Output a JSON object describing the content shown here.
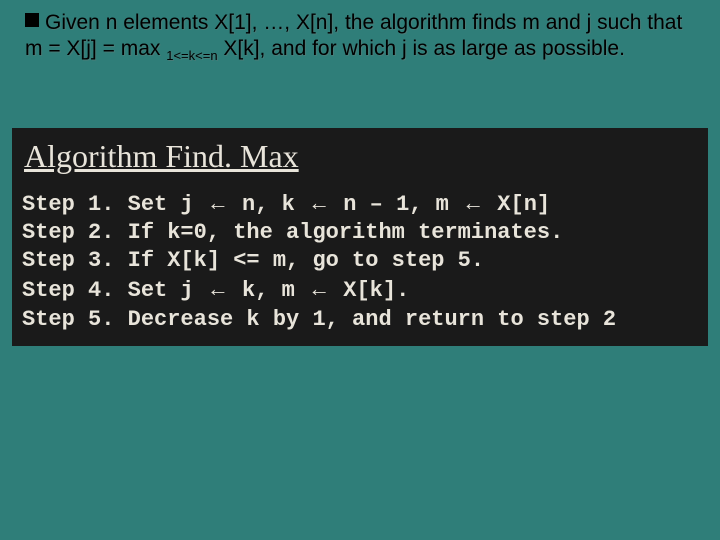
{
  "intro": {
    "part1": "Given n elements X[1], …, X[n], the algorithm finds m and j such that m = X[j] = max ",
    "subscript": "1<=k<=n",
    "part2": " X[k], and for which j is as large as possible."
  },
  "algorithm": {
    "title": "Algorithm Find. Max",
    "steps": {
      "s1a": "Step 1. Set j ",
      "s1b": " n, k ",
      "s1c": " n – 1, m ",
      "s1d": " X[n]",
      "s2": "Step 2. If k=0, the algorithm terminates.",
      "s3": "Step 3. If X[k] <= m, go to step 5.",
      "s4a": "Step 4. Set j ",
      "s4b": " k, m ",
      "s4c": " X[k].",
      "s5": "Step 5. Decrease k by 1, and return to step 2"
    },
    "arrow": "←"
  }
}
